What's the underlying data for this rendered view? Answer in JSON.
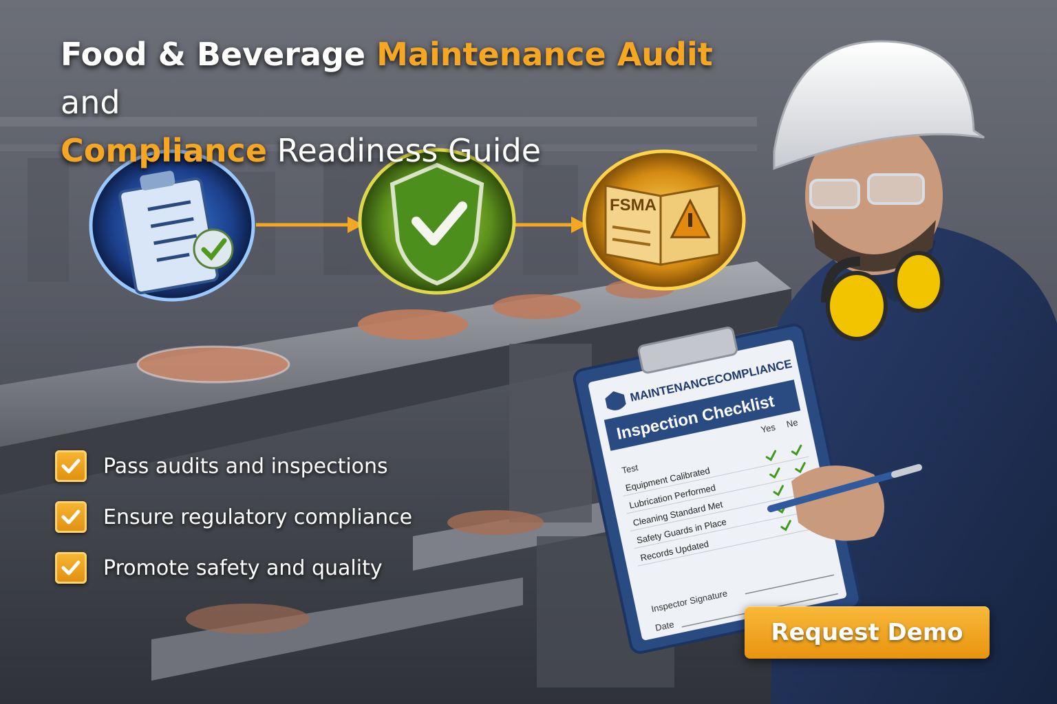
{
  "headline": {
    "part1": "Food & Beverage ",
    "part2": "Maintenance Audit",
    "part3": " and",
    "part4": "Compliance",
    "part5": " Readiness Guide"
  },
  "steps": [
    {
      "icon": "checklist-clipboard-icon",
      "color": "#2f6fd6"
    },
    {
      "icon": "shield-check-icon",
      "color": "#7cc52a"
    },
    {
      "icon": "fsma-book-icon",
      "color": "#f3b11f",
      "label": "FSMA"
    }
  ],
  "benefits": [
    {
      "text": "Pass audits and inspections"
    },
    {
      "text": "Ensure regulatory compliance"
    },
    {
      "text": "Promote safety and quality"
    }
  ],
  "clipboard": {
    "brand": "MAINTENANCECOMPLIANCE",
    "title": "Inspection Checklist",
    "col_yes": "Yes",
    "col_no": "Ne",
    "col_task": "Test",
    "items": [
      {
        "label": "Equipment Calibrated"
      },
      {
        "label": "Lubrication Performed"
      },
      {
        "label": "Cleaning Standard Met"
      },
      {
        "label": "Safety Guards in Place"
      },
      {
        "label": "Records Updated"
      }
    ],
    "signature_label": "Inspector Signature",
    "date_label": "Date"
  },
  "cta": {
    "label": "Request Demo"
  },
  "colors": {
    "accent": "#f5a623",
    "navy": "#1f3a6b",
    "background": "#4a4e57"
  }
}
